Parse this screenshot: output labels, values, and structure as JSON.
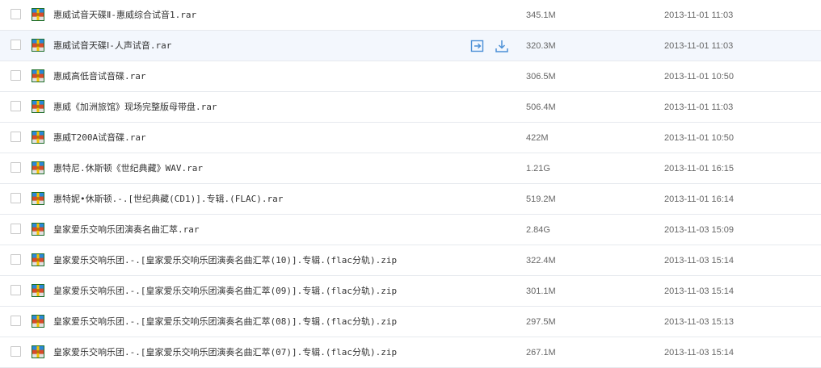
{
  "colors": {
    "row_border": "#e6e9ee",
    "row_hover": "#f3f7fd",
    "action_icon": "#4a8fd6",
    "text": "#333333",
    "meta_text": "#666666"
  },
  "row_actions": {
    "share_icon": "share-icon",
    "download_icon": "download-icon"
  },
  "files": [
    {
      "name": "惠威试音天碟Ⅱ-惠威综合试音1.rar",
      "size": "345.1M",
      "modified": "2013-11-01 11:03",
      "hovered": false
    },
    {
      "name": "惠威试音天碟Ⅰ-人声试音.rar",
      "size": "320.3M",
      "modified": "2013-11-01 11:03",
      "hovered": true
    },
    {
      "name": "惠威高低音试音碟.rar",
      "size": "306.5M",
      "modified": "2013-11-01 10:50",
      "hovered": false
    },
    {
      "name": "惠威《加洲旅馆》现场完整版母带盘.rar",
      "size": "506.4M",
      "modified": "2013-11-01 11:03",
      "hovered": false
    },
    {
      "name": "惠威T200A试音碟.rar",
      "size": "422M",
      "modified": "2013-11-01 10:50",
      "hovered": false
    },
    {
      "name": "惠特尼.休斯顿《世纪典藏》WAV.rar",
      "size": "1.21G",
      "modified": "2013-11-01 16:15",
      "hovered": false
    },
    {
      "name": "惠特妮•休斯顿.-.[世纪典藏(CD1)].专辑.(FLAC).rar",
      "size": "519.2M",
      "modified": "2013-11-01 16:14",
      "hovered": false
    },
    {
      "name": "皇家爱乐交响乐团演奏名曲汇萃.rar",
      "size": "2.84G",
      "modified": "2013-11-03 15:09",
      "hovered": false
    },
    {
      "name": "皇家爱乐交响乐团.-.[皇家爱乐交响乐团演奏名曲汇萃(10)].专辑.(flac分轨).zip",
      "size": "322.4M",
      "modified": "2013-11-03 15:14",
      "hovered": false
    },
    {
      "name": "皇家爱乐交响乐团.-.[皇家爱乐交响乐团演奏名曲汇萃(09)].专辑.(flac分轨).zip",
      "size": "301.1M",
      "modified": "2013-11-03 15:14",
      "hovered": false
    },
    {
      "name": "皇家爱乐交响乐团.-.[皇家爱乐交响乐团演奏名曲汇萃(08)].专辑.(flac分轨).zip",
      "size": "297.5M",
      "modified": "2013-11-03 15:13",
      "hovered": false
    },
    {
      "name": "皇家爱乐交响乐团.-.[皇家爱乐交响乐团演奏名曲汇萃(07)].专辑.(flac分轨).zip",
      "size": "267.1M",
      "modified": "2013-11-03 15:14",
      "hovered": false
    }
  ]
}
